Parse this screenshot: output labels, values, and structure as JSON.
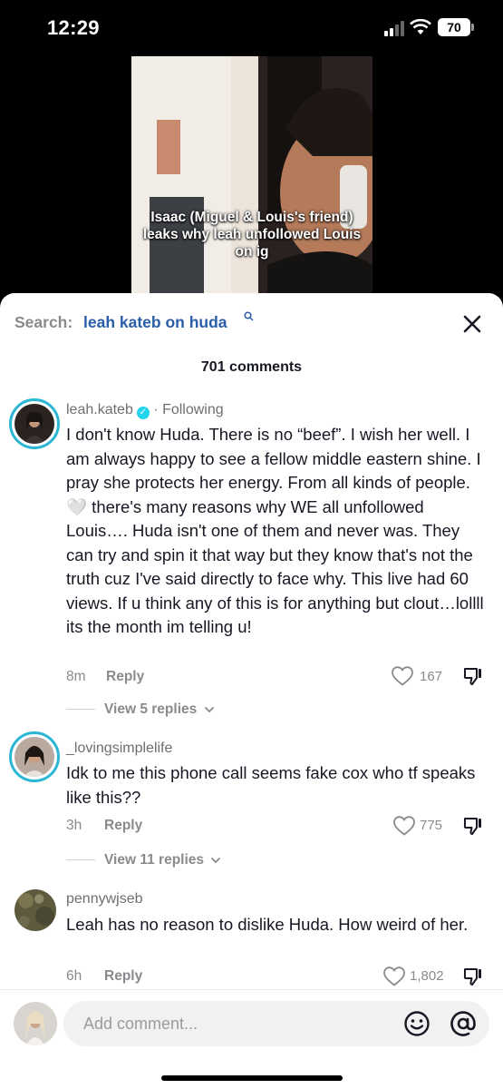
{
  "status_bar": {
    "time": "12:29",
    "battery": "70"
  },
  "video": {
    "caption": "Isaac (Miguel & Louis's friend) leaks why leah unfollowed Louis on ig"
  },
  "sheet": {
    "search_label": "Search:",
    "search_query": "leah kateb on huda",
    "comment_count": "701 comments"
  },
  "comments": [
    {
      "username": "leah.kateb",
      "verified": true,
      "following": "· Following",
      "text": "I don't know Huda. There is no “beef”. I wish her well. I am always happy to see a fellow middle eastern shine. I pray she protects her energy. From all kinds of people.🤍 there's many reasons why WE all unfollowed Louis…. Huda isn't one of them and never was. They can try and spin it that way but they know that's not the truth cuz I've said directly to face why. This live had 60 views. If u think any of this is for anything but clout…lollll its the month im telling u!",
      "time": "8m",
      "reply_label": "Reply",
      "likes": "167",
      "view_replies": "View 5 replies"
    },
    {
      "username": "_lovingsimplelife",
      "text": "Idk to me this phone call seems fake cox who tf speaks like this??",
      "time": "3h",
      "reply_label": "Reply",
      "likes": "775",
      "view_replies": "View 11 replies"
    },
    {
      "username": "pennywjseb",
      "text": "Leah has no reason to dislike Huda. How weird of her.",
      "time": "6h",
      "reply_label": "Reply",
      "likes": "1,802"
    }
  ],
  "input": {
    "placeholder": "Add comment..."
  },
  "colors": {
    "accent": "#2b5ea8",
    "ring": "#2bb7d4",
    "verified": "#20d5ec"
  },
  "icons": [
    "search-icon",
    "close-icon",
    "verified-icon",
    "heart-icon",
    "dislike-icon",
    "chevron-down-icon",
    "emoji-icon",
    "mention-icon"
  ]
}
